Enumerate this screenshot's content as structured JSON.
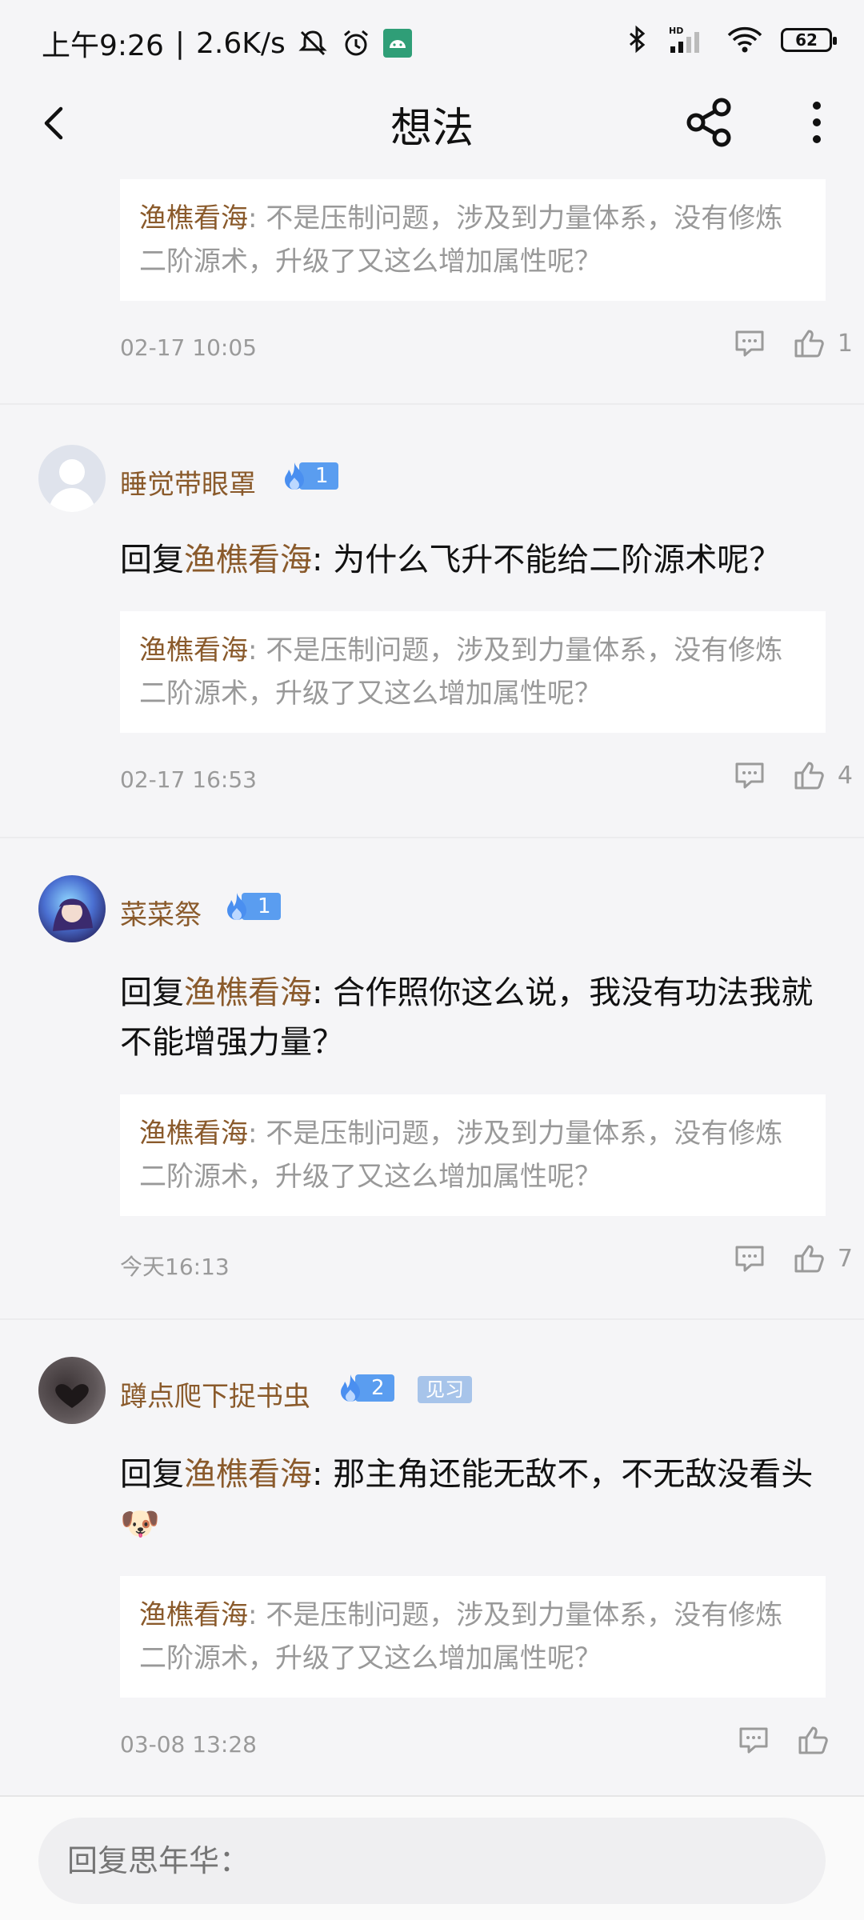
{
  "status_bar": {
    "time": "上午9:26",
    "speed": "2.6K/s",
    "battery": "62"
  },
  "header": {
    "title": "想法"
  },
  "comments": [
    {
      "quote_author": "渔樵看海",
      "quote_text": ": 不是压制问题，涉及到力量体系，没有修炼二阶源术，升级了又这么增加属性呢？",
      "time": "02-17 10:05",
      "likes": "1"
    },
    {
      "username": "睡觉带眼罩",
      "level": "1",
      "reply_prefix": "回复",
      "reply_to": "渔樵看海",
      "reply_text": ": 为什么飞升不能给二阶源术呢？",
      "quote_author": "渔樵看海",
      "quote_text": ": 不是压制问题，涉及到力量体系，没有修炼二阶源术，升级了又这么增加属性呢？",
      "time": "02-17 16:53",
      "likes": "4"
    },
    {
      "username": "菜菜祭",
      "level": "1",
      "reply_prefix": "回复",
      "reply_to": "渔樵看海",
      "reply_text": ": 合作照你这么说，我没有功法我就不能增强力量？",
      "quote_author": "渔樵看海",
      "quote_text": ": 不是压制问题，涉及到力量体系，没有修炼二阶源术，升级了又这么增加属性呢？",
      "time": "今天16:13",
      "likes": "7"
    },
    {
      "username": "蹲点爬下捉书虫",
      "level": "2",
      "tag": "见习",
      "reply_prefix": "回复",
      "reply_to": "渔樵看海",
      "reply_text": ": 那主角还能无敌不，不无敌没看头🐶",
      "quote_author": "渔樵看海",
      "quote_text": ": 不是压制问题，涉及到力量体系，没有修炼二阶源术，升级了又这么增加属性呢？",
      "time": "03-08 13:28",
      "likes": ""
    }
  ],
  "reply_input": {
    "placeholder": "回复思年华："
  },
  "colors": {
    "background": "#f5f5f7",
    "username": "#8a5a2b",
    "level_badge": "#5a9df0",
    "tag_badge": "#a7c4ea"
  }
}
